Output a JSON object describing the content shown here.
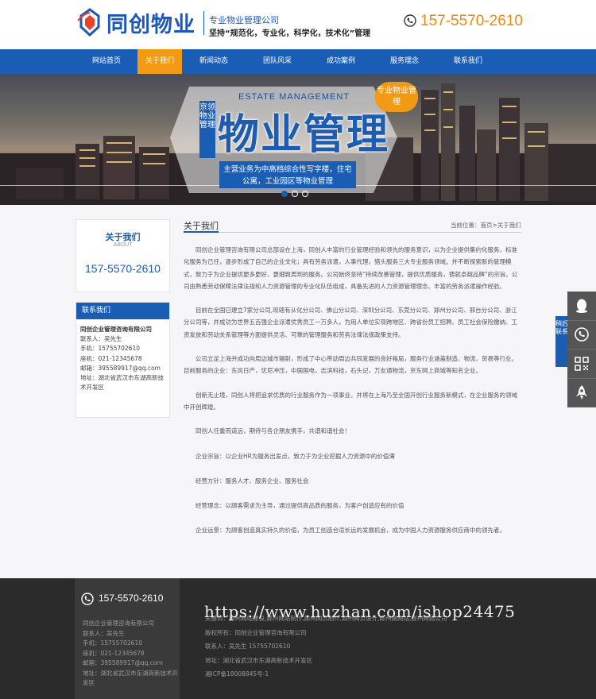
{
  "header": {
    "logo_text": "同创物业",
    "slogan1": "专业物业管理公司",
    "slogan2": "坚持“规范化，专业化，科学化，技术化”管理",
    "phone": "157-5570-2610"
  },
  "nav": {
    "items": [
      "网站首页",
      "关于我们",
      "新闻动态",
      "团队风采",
      "成功案例",
      "服务理念",
      "联系我们"
    ],
    "active_index": 1
  },
  "banner": {
    "en": "ESTATE MANAGEMENT",
    "vertical": "京领物业管理",
    "title": "物业管理",
    "sub": "主营业务为中高档综合性写字楼，住宅公寓，工业园区等物业管理",
    "badge": "专业物业管理"
  },
  "sidebar": {
    "about_title": "关于我们",
    "about_en": "ABOUT",
    "phone": "157-5570-2610",
    "contact_title": "联系我们",
    "company": "同创企业管理咨询有限公司",
    "contact_person": "联系人：吴先生",
    "mobile": "手机：15755702610",
    "landline": "座机：021-12345678",
    "email": "邮箱：395589917@qq.com",
    "address": "地址：湖北省武汉市东湖高新技术开发区"
  },
  "content": {
    "title": "关于我们",
    "breadcrumb": "当前位置：首页>关于我们",
    "paragraphs": [
      "同创企业管理咨询有限公司总部设在上海，同创人丰富的行业管理经验和领先的服务意识，以为企业提供集约化服务，标准化服务为己任，逐步形成了自己的企业文化；具有劳务派遣，人事代理，猎头服务三大专业服务领域。并不断探索新的管理模式，致力于为企业提供更多更好，更细致周到的服务。公司始终坚持“持续改善管理，提供优质服务，铸就卓越品牌”的宗旨。公司由熟悉劳动保障法律法规和人力资源管理的专业化队伍组成，具备先进的人力资源管理理念、丰富的劳务派遣操作经验。",
      "目前在全国已建立7家分公司,现辖有从化分公司、佛山分公司、深圳分公司、东莞分公司、郑州分公司、邢台分公司、浙江分公司等，并成功为世界五百强企业派遣优秀员工一万多人，为用人单位实现跨地区、跨省份员工招聘、员工社会保险缴纳、工资发放和劳动关系管理等方面提供灵活、可靠的管理服务和劳务法律法规政策支持。",
      "公司立足上海并成功向周边城市辐射，形成了中心带动周边共同发展的良好格局，服务行业涵盖制造、物流、贸易等行业。目前服务的企业：东风日产，优尼冲压，中国国电，志滨科技，石头记，万友通物流，京东网上商城等知名企业。",
      "创新无止境，同创人将把追求优质的行业服务作为一项事业，并将在上海乃至全国开创行业服务新模式，在企业服务的领域中开创辉煌。",
      "同创人任重而道远，期待与各企朋友携手，共谱和谐社会！",
      "企业宗旨：以企业HR为服务出发点，致力于为企业挖掘人力资源中的价值潭",
      "经营方针：服务人才、服务企业、服务社会",
      "经营理念：以顾客需求为主导，通过提供高品质的服务，为客户创造应有的价值",
      "企业远景：为顾客创造真实持久的价值，为员工创造合适长远的发展机会，成为中国人力资源服务供应商中的领先者。"
    ]
  },
  "float": {
    "tab": "稍后联系"
  },
  "footer": {
    "phone": "157-5570-2610",
    "left_lines": [
      "同创企业管理咨询有限公司",
      "联系人：吴先生",
      "手机：15755702610",
      "座机：021-12345678",
      "邮箱：395589917@qq.com",
      "地址：湖北省武汉市东湖高新技术开发区"
    ],
    "right_lines": [
      "关键词：廊州网站建设,廊州网站制作,廊州网页制作,廊州网页设计,廊州做网站,廊州网络公司",
      "版权所有：同创企业管理咨询有限公司",
      "联系人：吴先生 15755702610",
      "地址：湖北省武汉市东湖高新技术开发区",
      "湘ICP备18008845号-1"
    ],
    "watermark": "https://www.huzhan.com/ishop24475"
  },
  "colors": {
    "brand_blue": "#1a5db5",
    "accent_orange": "#f39a14",
    "footer_bg": "#2b2b2b"
  }
}
